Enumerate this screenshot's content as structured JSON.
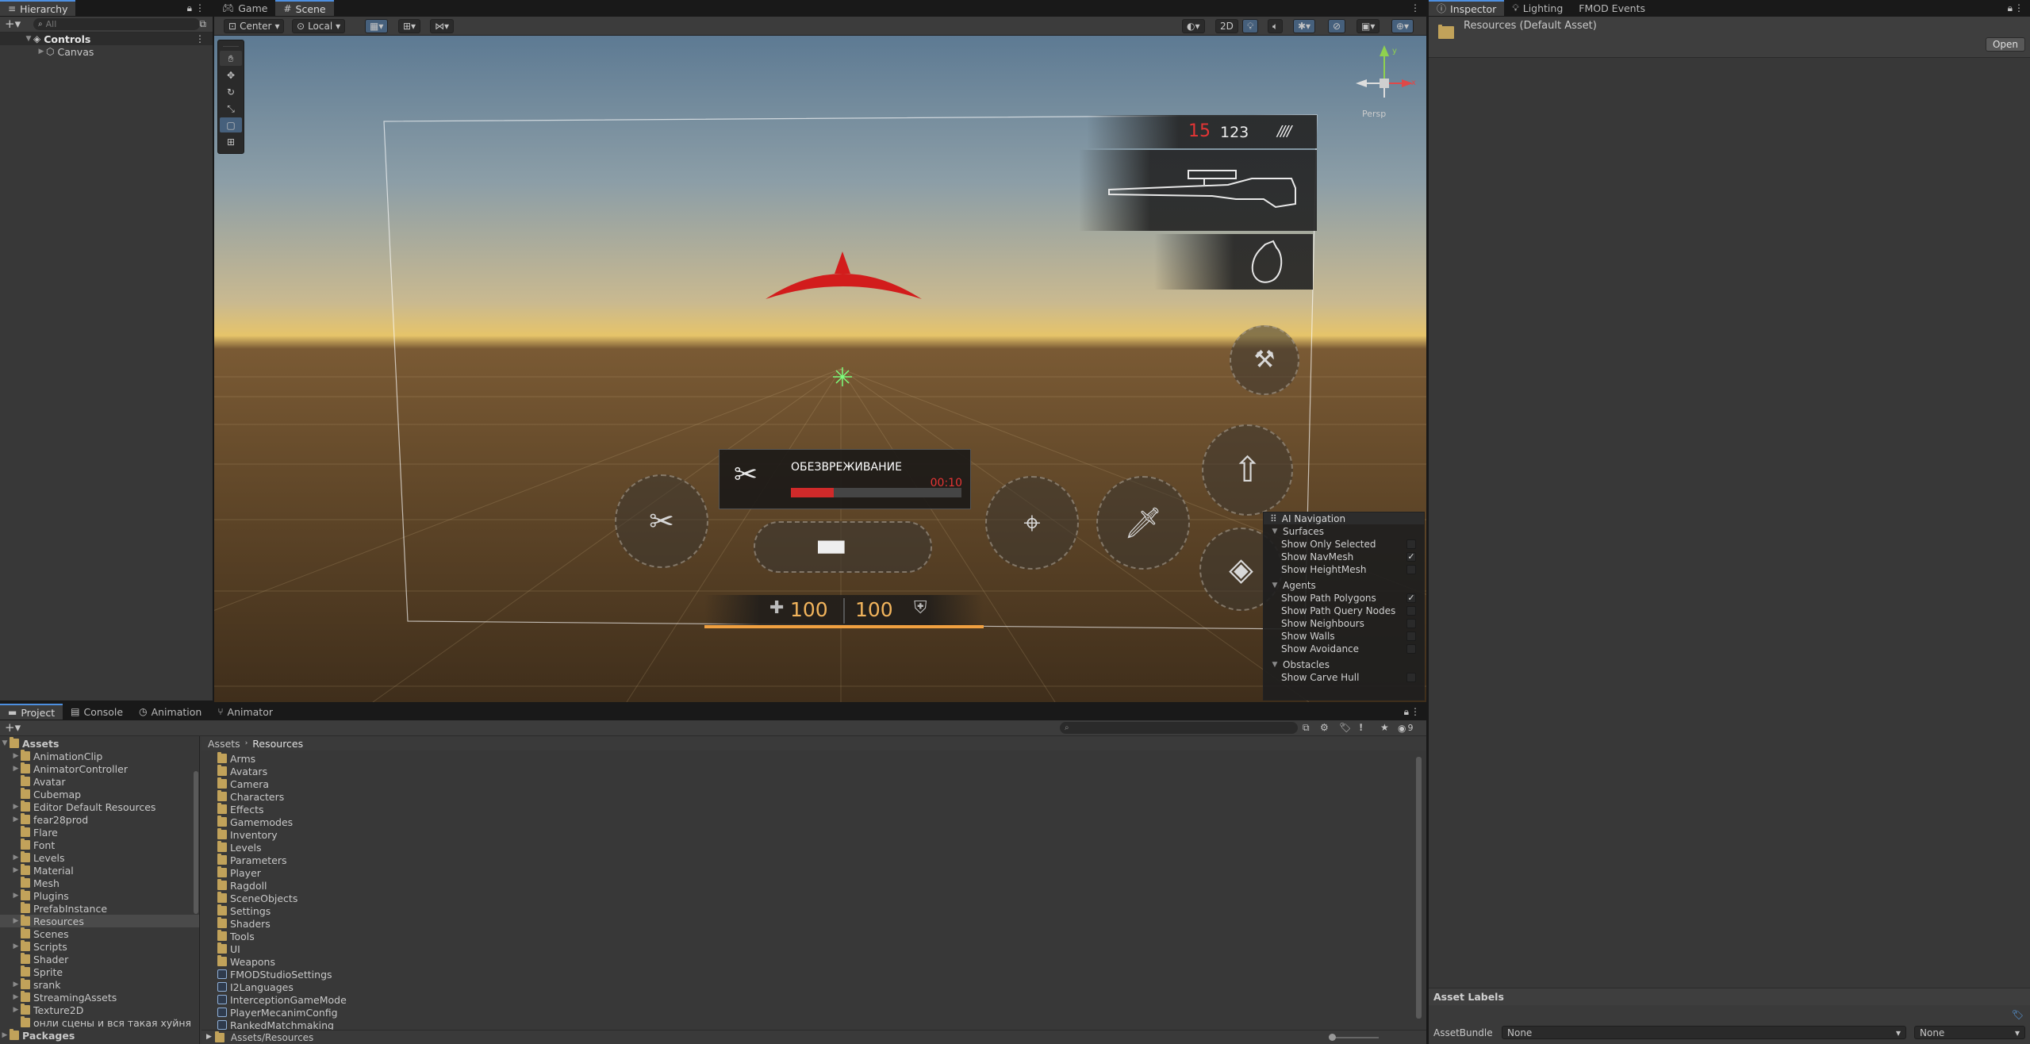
{
  "hierarchy": {
    "tab": "Hierarchy",
    "search_placeholder": "All",
    "root": "Controls",
    "child": "Canvas"
  },
  "scene_tabs": [
    "Game",
    "Scene"
  ],
  "scene_toolbar": {
    "pivot": "Center",
    "space": "Local",
    "mode_2d": "2D"
  },
  "gizmo": {
    "persp": "Persp",
    "x": "x",
    "y": "y"
  },
  "hud": {
    "ammo_clip": "15",
    "ammo_reserve": "123",
    "ammo_marks": "////",
    "defuse_title": "ОБЕЗВРЕЖИВАНИЕ",
    "defuse_timer": "00:10",
    "defuse_progress": 0.25,
    "health": "100",
    "armor": "100"
  },
  "ai_nav": {
    "title": "AI Navigation",
    "surfaces_label": "Surfaces",
    "surfaces": [
      {
        "label": "Show Only Selected",
        "checked": false
      },
      {
        "label": "Show NavMesh",
        "checked": true
      },
      {
        "label": "Show HeightMesh",
        "checked": false
      }
    ],
    "agents_label": "Agents",
    "agents": [
      {
        "label": "Show Path Polygons",
        "checked": true
      },
      {
        "label": "Show Path Query Nodes",
        "checked": false
      },
      {
        "label": "Show Neighbours",
        "checked": false
      },
      {
        "label": "Show Walls",
        "checked": false
      },
      {
        "label": "Show Avoidance",
        "checked": false
      }
    ],
    "obstacles_label": "Obstacles",
    "obstacles": [
      {
        "label": "Show Carve Hull",
        "checked": false
      }
    ]
  },
  "bottom_tabs": [
    "Project",
    "Console",
    "Animation",
    "Animator"
  ],
  "project": {
    "tree_root": "Assets",
    "tree": [
      "AnimationClip",
      "AnimatorController",
      "Avatar",
      "Cubemap",
      "Editor Default Resources",
      "fear28prod",
      "Flare",
      "Font",
      "Levels",
      "Material",
      "Mesh",
      "Plugins",
      "PrefabInstance",
      "Resources",
      "Scenes",
      "Scripts",
      "Shader",
      "Sprite",
      "srank",
      "StreamingAssets",
      "Texture2D",
      "онли сцены и вся такая хуйня"
    ],
    "packages": "Packages",
    "breadcrumb": [
      "Assets",
      "Resources"
    ],
    "folders": [
      "Arms",
      "Avatars",
      "Camera",
      "Characters",
      "Effects",
      "Gamemodes",
      "Inventory",
      "Levels",
      "Parameters",
      "Player",
      "Ragdoll",
      "SceneObjects",
      "Settings",
      "Shaders",
      "Tools",
      "UI",
      "Weapons"
    ],
    "assets": [
      "FMODStudioSettings",
      "I2Languages",
      "InterceptionGameMode",
      "PlayerMecanimConfig",
      "RankedMatchmaking"
    ],
    "footer_path": "Assets/Resources",
    "hidden_count": "9"
  },
  "inspector": {
    "tabs": [
      "Inspector",
      "Lighting",
      "FMOD Events"
    ],
    "title": "Resources (Default Asset)",
    "open_button": "Open",
    "asset_labels": "Asset Labels",
    "asset_bundle_label": "AssetBundle",
    "bundle_value": "None",
    "variant_value": "None"
  }
}
